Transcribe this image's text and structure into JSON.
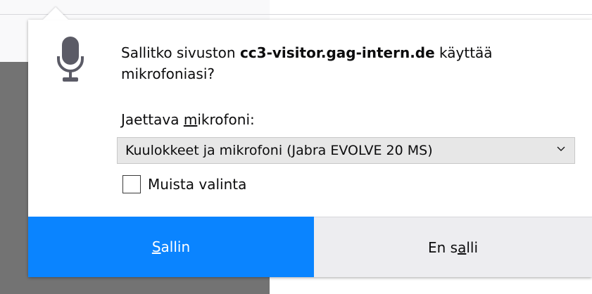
{
  "prompt": {
    "message_prefix": "Sallitko sivuston ",
    "site": "cc3-visitor.gag-intern.de",
    "message_suffix": " käyttää mikrofoniasi?"
  },
  "device": {
    "label_before": "Jaettava ",
    "label_accel": "m",
    "label_after": "ikrofoni:",
    "selected": "Kuulokkeet ja mikrofoni (Jabra EVOLVE 20 MS)"
  },
  "remember": {
    "label": "Muista valinta",
    "checked": false
  },
  "buttons": {
    "allow_accel": "S",
    "allow_rest": "allin",
    "deny_before": "En s",
    "deny_accel": "a",
    "deny_after": "lli"
  },
  "icons": {
    "prompt_icon": "microphone-icon",
    "select_arrow": "chevron-down-icon"
  },
  "colors": {
    "primary_button": "#0a84ff",
    "secondary_button": "#ededf0"
  }
}
